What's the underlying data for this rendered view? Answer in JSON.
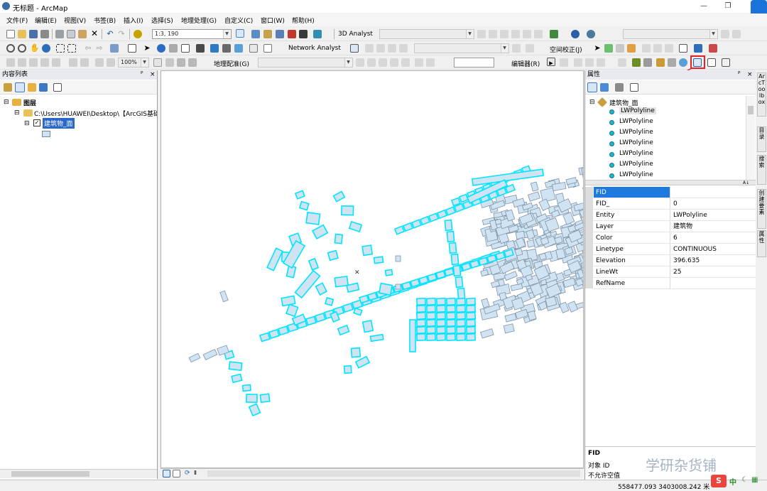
{
  "window": {
    "title": "无标题 - ArcMap"
  },
  "menu": [
    "文件(F)",
    "编辑(E)",
    "视图(V)",
    "书签(B)",
    "插入(I)",
    "选择(S)",
    "地理处理(G)",
    "自定义(C)",
    "窗口(W)",
    "帮助(H)"
  ],
  "toolbar": {
    "scale": "1:3, 190",
    "analyst3d": "3D Analyst",
    "network_analyst": "Network Analyst",
    "spatial_adjust": "空间校正(J)",
    "georef": "地理配准(G)",
    "editor": "编辑器(R)",
    "zoom": "100%"
  },
  "toc": {
    "title": "内容列表",
    "layers_label": "图层",
    "folder_path": "C:\\Users\\HUAWEI\\Desktop\\【ArcGIS基础",
    "layer_name": "建筑物_面"
  },
  "attributes": {
    "title": "属性",
    "root": "建筑物_面",
    "features": [
      "LWPolyline",
      "LWPolyline",
      "LWPolyline",
      "LWPolyline",
      "LWPolyline",
      "LWPolyline",
      "LWPolyline"
    ],
    "fields": [
      {
        "name": "FID",
        "value": ""
      },
      {
        "name": "FID_",
        "value": "0"
      },
      {
        "name": "Entity",
        "value": "LWPolyline"
      },
      {
        "name": "Layer",
        "value": "建筑物"
      },
      {
        "name": "Color",
        "value": "6"
      },
      {
        "name": "Linetype",
        "value": "CONTINUOUS"
      },
      {
        "name": "Elevation",
        "value": "396.635"
      },
      {
        "name": "LineWt",
        "value": "25"
      },
      {
        "name": "RefName",
        "value": ""
      }
    ],
    "desc_title": "FID",
    "desc_line1": "对象 ID",
    "desc_line2": "不允许空值"
  },
  "right_tabs": [
    "ArcToolbox",
    "目录",
    "搜索",
    "创建要素",
    "属性"
  ],
  "status": {
    "coords": "558477.093  3403008.242 米"
  },
  "watermark": "学研杂货铺",
  "colors": {
    "selected": "#00e5ff",
    "fill": "#cfe3f3",
    "outline": "#7f93a8",
    "accent": "#1a73d8"
  }
}
